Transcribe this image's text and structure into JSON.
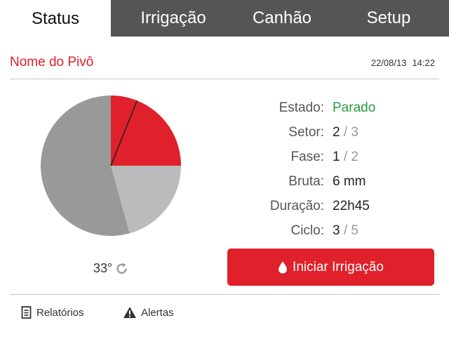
{
  "tabs": [
    {
      "label": "Status",
      "active": true
    },
    {
      "label": "Irrigação",
      "active": false
    },
    {
      "label": "Canhão",
      "active": false
    },
    {
      "label": "Setup",
      "active": false
    }
  ],
  "header": {
    "pivot_name": "Nome do Pivô",
    "date": "22/08/13",
    "time": "14:22"
  },
  "pie": {
    "sectors": [
      {
        "name": "setor-1",
        "share": 0.061,
        "color": "#e0202a"
      },
      {
        "name": "setor-2",
        "share": 0.189,
        "color": "#e0202a"
      },
      {
        "name": "setor-3",
        "share": 0.207,
        "color": "#bbbbbb"
      },
      {
        "name": "setor-4",
        "share": 0.543,
        "color": "#999999"
      }
    ]
  },
  "angle": {
    "value": "33°",
    "icon": "refresh-icon"
  },
  "info": {
    "estado_label": "Estado:",
    "estado_value": "Parado",
    "setor_label": "Setor:",
    "setor_current": "2",
    "setor_total": "3",
    "fase_label": "Fase:",
    "fase_current": "1",
    "fase_total": "2",
    "bruta_label": "Bruta:",
    "bruta_value": "6 mm",
    "duracao_label": "Duração:",
    "duracao_value": "22h45",
    "ciclo_label": "Ciclo:",
    "ciclo_current": "3",
    "ciclo_total": "5",
    "separator": "/"
  },
  "action": {
    "start_label": "Iniciar Irrigação",
    "icon": "water-drop-icon"
  },
  "footer": {
    "reports_label": "Relatórios",
    "alerts_label": "Alertas"
  },
  "colors": {
    "accent": "#e0202a",
    "status_ok": "#2a9a3a",
    "tab_bg": "#555555"
  }
}
